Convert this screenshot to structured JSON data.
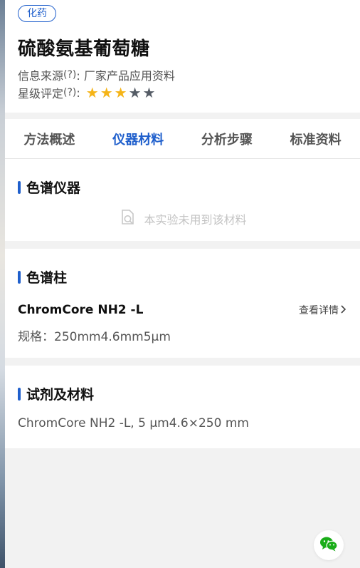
{
  "header": {
    "tag": "化药",
    "title": "硫酸氨基葡萄糖",
    "source_label": "信息来源",
    "help_glyph": "?",
    "source_value": ": 厂家产品应用资料",
    "rating_label": "星级评定",
    "rating_sep": ":",
    "rating": {
      "value": 3,
      "max": 5,
      "filled_color": "#f5b417",
      "empty_color": "#555c66"
    }
  },
  "tabs": [
    {
      "label": "方法概述",
      "active": false
    },
    {
      "label": "仪器材料",
      "active": true
    },
    {
      "label": "分析步骤",
      "active": false
    },
    {
      "label": "标准资料",
      "active": false
    }
  ],
  "instrument": {
    "title": "色谱仪器",
    "empty_text": "本实验未用到该材料",
    "empty_icon": "document-search-icon"
  },
  "column": {
    "title": "色谱柱",
    "name": "ChromCore NH2 -L",
    "detail_label": "查看详情",
    "detail_icon": "chevron-right-icon",
    "spec": "规格：250mm4.6mm5μm"
  },
  "reagents": {
    "title": "试剂及材料",
    "text": "ChromCore NH2 -L, 5 μm4.6×250 mm"
  },
  "floating": {
    "icon": "wechat-icon",
    "color": "#1aad19"
  },
  "accent_color": "#1f5fcc"
}
